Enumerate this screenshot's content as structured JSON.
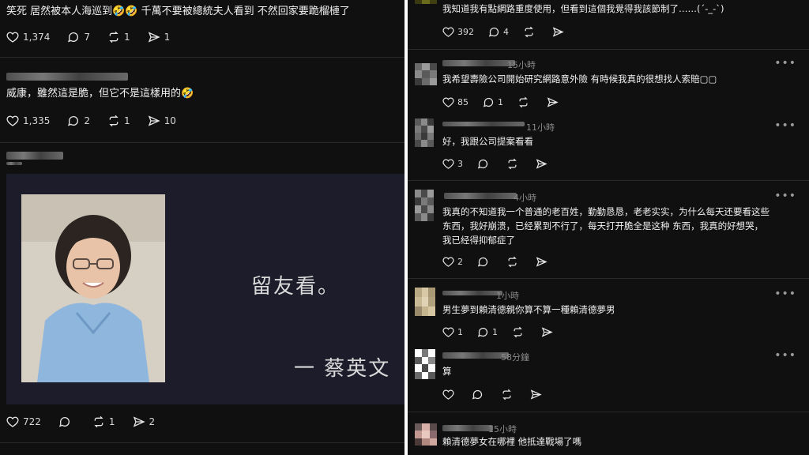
{
  "left": {
    "posts": [
      {
        "text": "笑死 居然被本人海巡到🤣🤣 千萬不要被總統夫人看到 不然回家要跪榴槤了",
        "likes": "1,374",
        "comments": "7",
        "reposts": "1",
        "shares": "1"
      },
      {
        "text": "威康，雖然這是脆，但它不是這樣用的🤣",
        "likes": "1,335",
        "comments": "2",
        "reposts": "1",
        "shares": "10"
      },
      {
        "image_quote": "留友看。",
        "image_author": "一 蔡英文",
        "likes": "722",
        "comments": "",
        "reposts": "1",
        "shares": "2"
      }
    ]
  },
  "right": {
    "comments": [
      {
        "text": "我知道我有點網路重度使用，但看到這個我覺得我該節制了……(´-_-`)",
        "time": "",
        "likes": "392",
        "replies": "4",
        "reposts": "",
        "shares": ""
      },
      {
        "time": "15小時",
        "text": "我希望壽險公司開始研究網路意外險 有時候我真的很想找人索賠▢▢",
        "likes": "85",
        "replies": "1",
        "reposts": "",
        "shares": ""
      },
      {
        "time": "11小時",
        "text": "好，我跟公司提案看看",
        "likes": "3",
        "replies": "",
        "reposts": "",
        "shares": ""
      },
      {
        "time": "4小時",
        "text_lines": [
          "我真的不知道我一个普通的老百姓，勤勤恳恳，老老实实，为什么每天还要看这些",
          "东西，我好崩溃，已经累到不行了，每天打开脆全是这种 东西，我真的好想哭，",
          "我已经得抑郁症了"
        ],
        "likes": "2",
        "replies": "",
        "reposts": "",
        "shares": ""
      },
      {
        "time": "1小時",
        "text": "男生夢到賴清德親你算不算一種賴清德夢男",
        "likes": "1",
        "replies": "1",
        "reposts": "",
        "shares": ""
      },
      {
        "time": "58分鐘",
        "text": "算",
        "likes": "",
        "replies": "",
        "reposts": "",
        "shares": ""
      },
      {
        "time": "15小時",
        "text": "賴清德夢女在哪裡 他抵達戰場了嗎",
        "likes": "",
        "replies": "",
        "reposts": "",
        "shares": ""
      }
    ],
    "more_label": "•••"
  },
  "colors": {
    "background": "#101010",
    "text": "#f1f1f1",
    "muted": "#8a8a8a",
    "image_bg": "#1d1c2b"
  }
}
